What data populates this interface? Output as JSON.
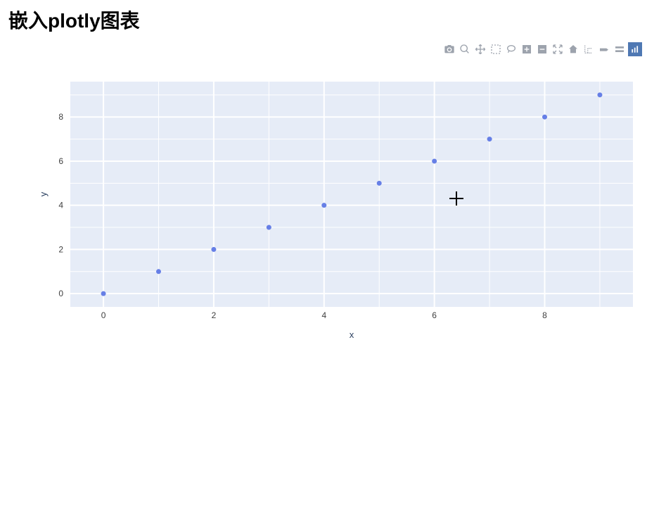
{
  "heading": "嵌入plotly图表",
  "toolbar": {
    "items": [
      {
        "name": "camera-icon",
        "title": "Download plot as a png"
      },
      {
        "name": "zoom-icon",
        "title": "Zoom"
      },
      {
        "name": "pan-icon",
        "title": "Pan"
      },
      {
        "name": "box-select-icon",
        "title": "Box Select"
      },
      {
        "name": "lasso-select-icon",
        "title": "Lasso Select"
      },
      {
        "name": "zoom-in-icon",
        "title": "Zoom in"
      },
      {
        "name": "zoom-out-icon",
        "title": "Zoom out"
      },
      {
        "name": "autoscale-icon",
        "title": "Autoscale"
      },
      {
        "name": "reset-axes-icon",
        "title": "Reset axes"
      },
      {
        "name": "spike-lines-icon",
        "title": "Toggle Spike Lines"
      },
      {
        "name": "hover-closest-icon",
        "title": "Show closest data on hover"
      },
      {
        "name": "hover-compare-icon",
        "title": "Compare data on hover"
      },
      {
        "name": "plotly-logo-icon",
        "title": "Produced with Plotly"
      }
    ]
  },
  "chart_data": {
    "type": "scatter",
    "x": [
      0,
      1,
      2,
      3,
      4,
      5,
      6,
      7,
      8,
      9
    ],
    "y": [
      0,
      1,
      2,
      3,
      4,
      5,
      6,
      7,
      8,
      9
    ],
    "xlabel": "x",
    "ylabel": "y",
    "xticks": [
      0,
      2,
      4,
      6,
      8
    ],
    "yticks": [
      0,
      2,
      4,
      6,
      8
    ],
    "xlim": [
      -0.6,
      9.6
    ],
    "ylim": [
      -0.6,
      9.6
    ],
    "marker_color": "#667fe6",
    "plot_bg": "#e6ecf7",
    "grid_color": "#ffffff"
  },
  "cursor": {
    "x_data": 6.4,
    "y_data": 4.3
  }
}
